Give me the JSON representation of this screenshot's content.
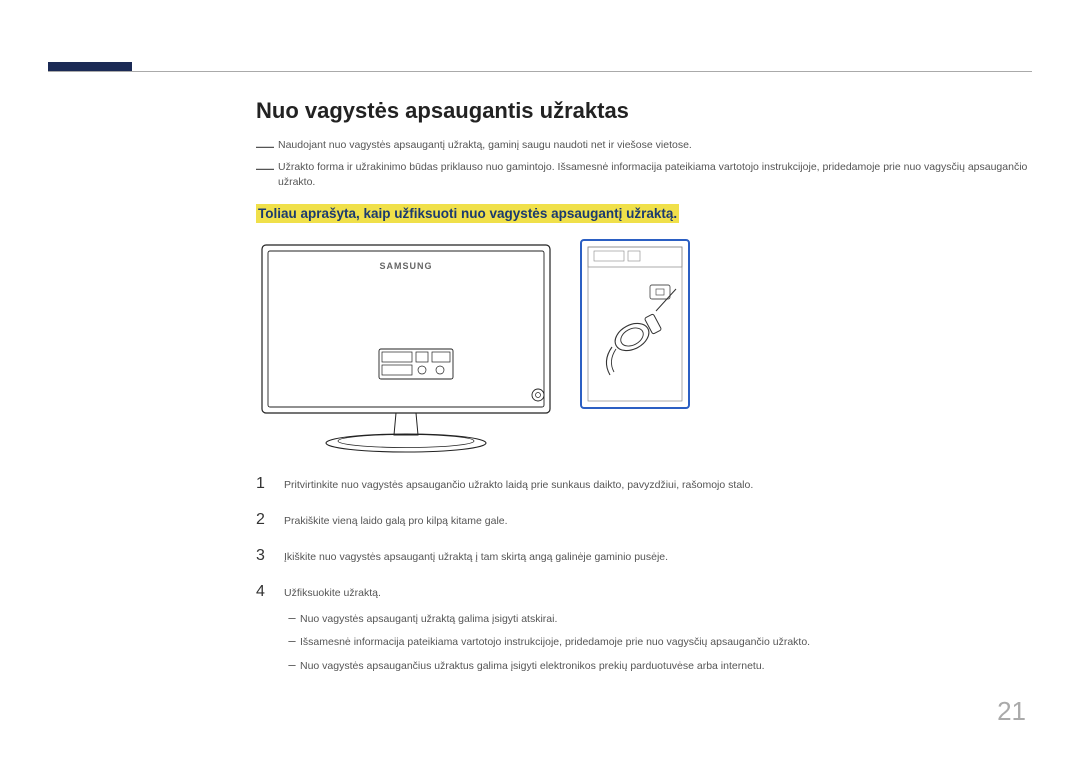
{
  "page": {
    "number": "21"
  },
  "heading": "Nuo vagystės apsaugantis užraktas",
  "notes": [
    "Naudojant nuo vagystės apsaugantį užraktą, gaminį saugu naudoti net ir viešose vietose.",
    "Užrakto forma ir užrakinimo būdas priklauso nuo gamintojo. Išsamesnė informacija pateikiama vartotojo instrukcijoje, pridedamoje prie nuo vagysčių apsaugančio užrakto."
  ],
  "highlight": "Toliau aprašyta, kaip užfiksuoti nuo vagystės apsaugantį užraktą.",
  "diagram": {
    "brand_label": "SAMSUNG"
  },
  "steps": [
    {
      "num": "1",
      "text": "Pritvirtinkite nuo vagystės apsaugančio užrakto laidą prie sunkaus daikto, pavyzdžiui, rašomojo stalo."
    },
    {
      "num": "2",
      "text": "Prakiškite vieną laido galą pro kilpą kitame gale."
    },
    {
      "num": "3",
      "text": "Įkiškite nuo vagystės apsaugantį užraktą į tam skirtą angą galinėje gaminio pusėje."
    },
    {
      "num": "4",
      "text": "Užfiksuokite užraktą."
    }
  ],
  "sub_bullets": [
    "Nuo vagystės apsaugantį užraktą galima įsigyti atskirai.",
    "Išsamesnė informacija pateikiama vartotojo instrukcijoje, pridedamoje prie nuo vagysčių apsaugančio užrakto.",
    "Nuo vagystės apsaugančius užraktus galima įsigyti elektronikos prekių parduotuvėse arba internetu."
  ]
}
